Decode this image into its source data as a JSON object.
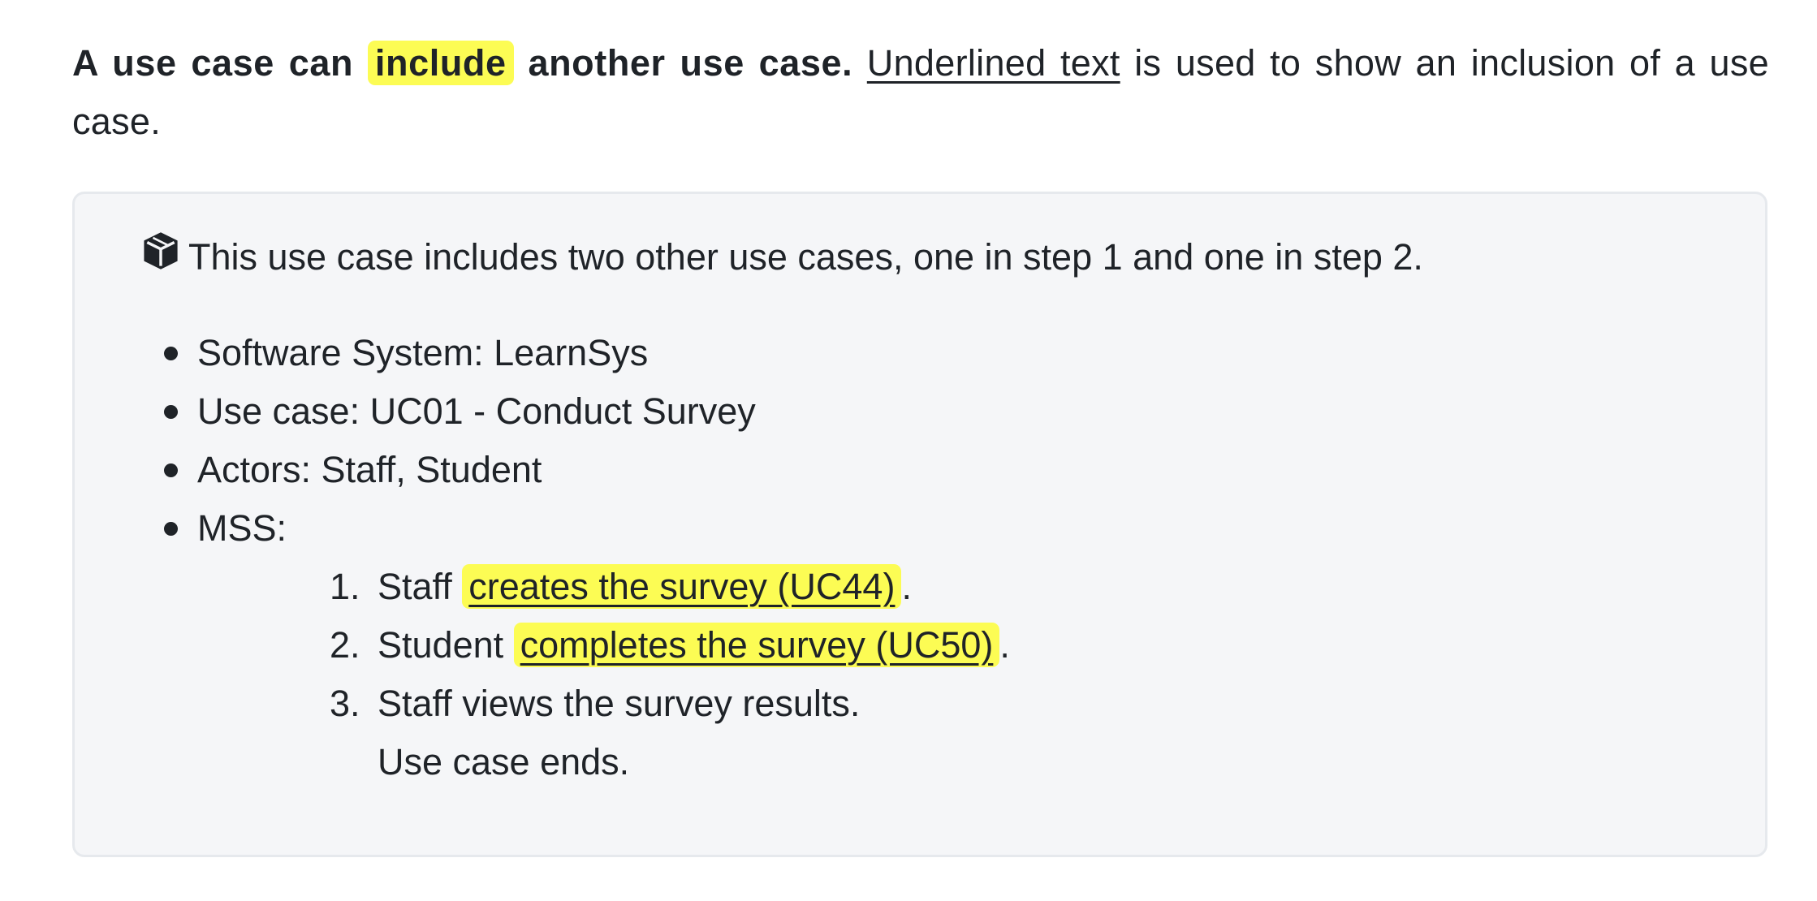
{
  "intro": {
    "bold_prefix": "A use case can ",
    "highlight": "include",
    "bold_suffix": " another use case.",
    "underlined": "Underlined text",
    "rest": " is used to show an inclusion of a use case."
  },
  "box": {
    "note_icon": "cube-icon",
    "note": "This use case includes two other use cases, one in step 1 and one in step 2.",
    "details": [
      "Software System: LearnSys",
      "Use case: UC01 - Conduct Survey",
      "Actors: Staff, Student"
    ],
    "mss_label": "MSS:",
    "steps": [
      {
        "num": "1.",
        "prefix": "Staff ",
        "link": "creates the survey (UC44)",
        "suffix": "."
      },
      {
        "num": "2.",
        "prefix": "Student ",
        "link": "completes the survey (UC50)",
        "suffix": "."
      },
      {
        "num": "3.",
        "prefix": "Staff views the survey results.",
        "link": "",
        "suffix": ""
      }
    ],
    "ending": "Use case ends."
  },
  "colors": {
    "highlight": "#fcfc54",
    "box_background": "#f5f6f8",
    "box_border": "#e6e9ed",
    "text": "#1f2328"
  }
}
